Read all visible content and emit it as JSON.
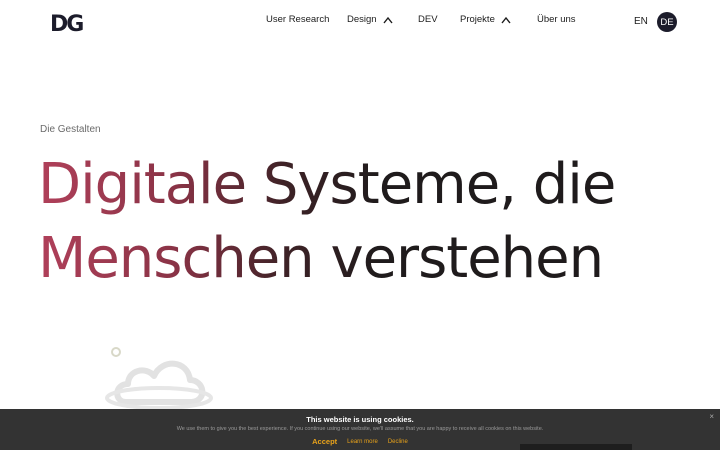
{
  "header": {
    "logo_text": "DG",
    "nav": [
      {
        "label": "User Research",
        "has_dropdown": false
      },
      {
        "label": "Design",
        "has_dropdown": true
      },
      {
        "label": "DEV",
        "has_dropdown": false
      },
      {
        "label": "Projekte",
        "has_dropdown": true
      },
      {
        "label": "Über uns",
        "has_dropdown": false
      }
    ],
    "languages": {
      "en": "EN",
      "de": "DE",
      "active": "DE"
    }
  },
  "hero": {
    "eyebrow": "Die Gestalten",
    "headline_line1": "Digitale Systeme, die",
    "headline_line2": "Menschen verstehen"
  },
  "cookie_banner": {
    "title": "This website is using cookies.",
    "text": "We use them to give you the best experience. If you continue using our website, we'll assume that you are happy to receive all cookies on this website.",
    "accept_label": "Accept",
    "learn_more_label": "Learn more",
    "decline_label": "Decline",
    "close_glyph": "×"
  },
  "colors": {
    "accent_gradient_start": "#b0405a",
    "text_dark": "#1f1b1c",
    "cookie_bg": "#333333",
    "cookie_action": "#e8a21a",
    "lang_active_bg": "#1c1c2b"
  }
}
